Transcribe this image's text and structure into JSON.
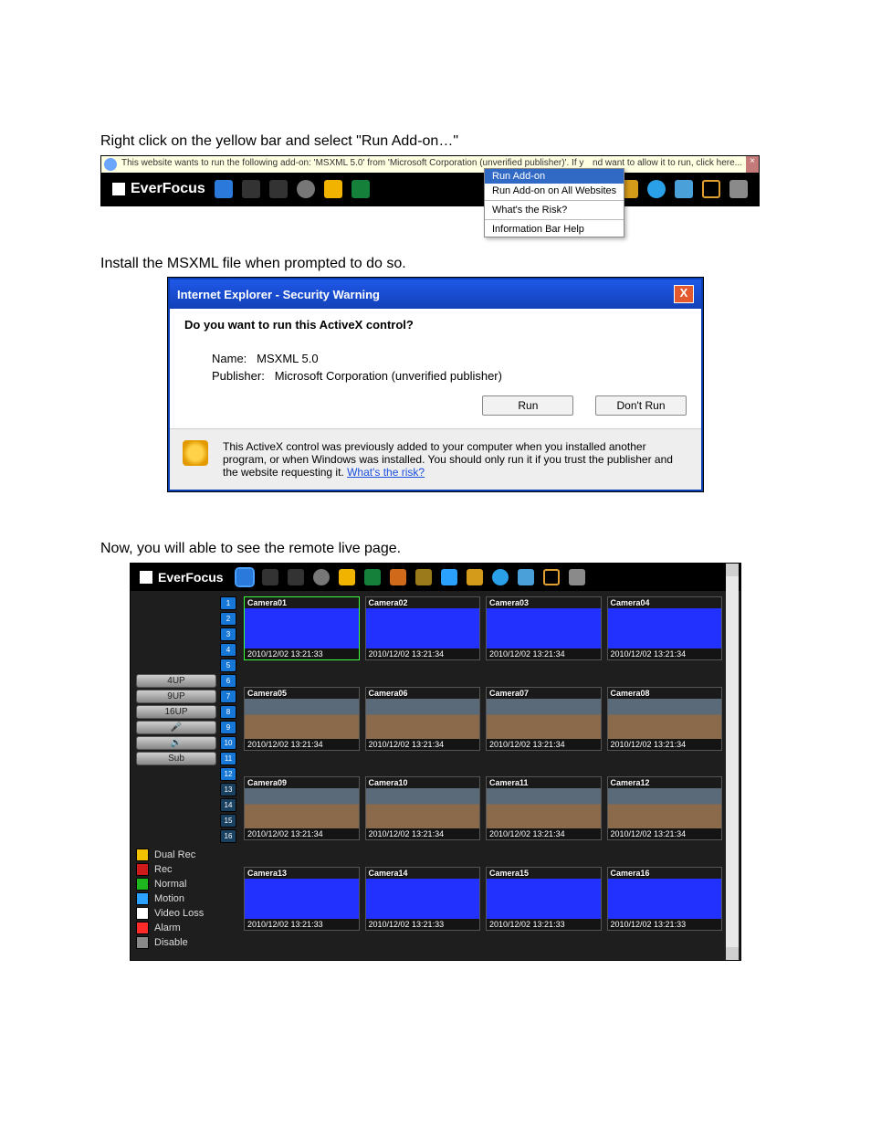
{
  "doc": {
    "step1": "Right click on the yellow bar and select \"Run Add-on…\"",
    "step2": "Install the MSXML file when prompted to do so.",
    "step3": "Now, you will able to see the remote live page."
  },
  "infobar": {
    "message_left": "This website wants to run the following add-on: 'MSXML 5.0' from 'Microsoft Corporation (unverified publisher)'. If y",
    "message_right": "nd want to allow it to run, click here...",
    "menu": {
      "run": "Run Add-on",
      "run_all": "Run Add-on on All Websites",
      "risk": "What's the Risk?",
      "help": "Information Bar Help"
    }
  },
  "everfocus": {
    "brand": "EverFocus"
  },
  "dialog": {
    "title": "Internet Explorer - Security Warning",
    "question": "Do you want to run this ActiveX control?",
    "name_label": "Name:",
    "name_value": "MSXML 5.0",
    "publisher_label": "Publisher:",
    "publisher_value": "Microsoft Corporation (unverified publisher)",
    "btn_run": "Run",
    "btn_dont": "Don't Run",
    "footer_text": "This ActiveX control was previously added to your computer when you installed another program, or when Windows was installed. You should only run it if you trust the publisher and the website requesting it.  ",
    "footer_link": "What's the risk?"
  },
  "live": {
    "side_buttons": {
      "b4": "4UP",
      "b9": "9UP",
      "b16": "16UP",
      "mic": "🎤",
      "spk": "🔊",
      "sub": "Sub"
    },
    "channels": [
      "1",
      "2",
      "3",
      "4",
      "5",
      "6",
      "7",
      "8",
      "9",
      "10",
      "11",
      "12",
      "13",
      "14",
      "15",
      "16"
    ],
    "legend": [
      {
        "color": "#f2c200",
        "label": "Dual Rec"
      },
      {
        "color": "#d01a1a",
        "label": "Rec"
      },
      {
        "color": "#1eb81e",
        "label": "Normal"
      },
      {
        "color": "#2aa0ff",
        "label": "Motion"
      },
      {
        "color": "#fff",
        "label": "Video Loss"
      },
      {
        "color": "#ff2a2a",
        "label": "Alarm"
      },
      {
        "color": "#888",
        "label": "Disable"
      }
    ],
    "cameras": [
      {
        "name": "Camera01",
        "ts": "2010/12/02 13:21:33",
        "feed": "blue"
      },
      {
        "name": "Camera02",
        "ts": "2010/12/02 13:21:34",
        "feed": "blue"
      },
      {
        "name": "Camera03",
        "ts": "2010/12/02 13:21:34",
        "feed": "blue"
      },
      {
        "name": "Camera04",
        "ts": "2010/12/02 13:21:34",
        "feed": "blue"
      },
      {
        "name": "Camera05",
        "ts": "2010/12/02 13:21:34",
        "feed": "img"
      },
      {
        "name": "Camera06",
        "ts": "2010/12/02 13:21:34",
        "feed": "img"
      },
      {
        "name": "Camera07",
        "ts": "2010/12/02 13:21:34",
        "feed": "img"
      },
      {
        "name": "Camera08",
        "ts": "2010/12/02 13:21:34",
        "feed": "img"
      },
      {
        "name": "Camera09",
        "ts": "2010/12/02 13:21:34",
        "feed": "img"
      },
      {
        "name": "Camera10",
        "ts": "2010/12/02 13:21:34",
        "feed": "img"
      },
      {
        "name": "Camera11",
        "ts": "2010/12/02 13:21:34",
        "feed": "img"
      },
      {
        "name": "Camera12",
        "ts": "2010/12/02 13:21:34",
        "feed": "img"
      },
      {
        "name": "Camera13",
        "ts": "2010/12/02 13:21:33",
        "feed": "blue"
      },
      {
        "name": "Camera14",
        "ts": "2010/12/02 13:21:33",
        "feed": "blue"
      },
      {
        "name": "Camera15",
        "ts": "2010/12/02 13:21:33",
        "feed": "blue"
      },
      {
        "name": "Camera16",
        "ts": "2010/12/02 13:21:33",
        "feed": "blue"
      }
    ]
  }
}
